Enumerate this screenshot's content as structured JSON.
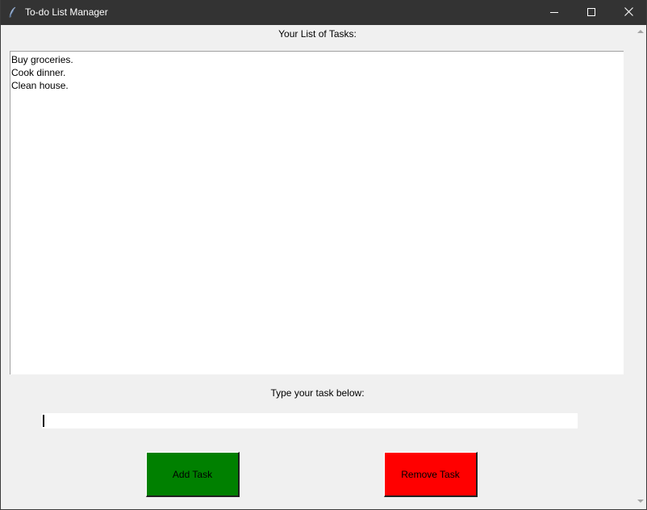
{
  "window": {
    "title": "To-do List Manager",
    "icon": "feather-icon"
  },
  "list": {
    "label": "Your List of Tasks:",
    "items": [
      "Buy groceries.",
      "Cook dinner.",
      "Clean house."
    ]
  },
  "entry": {
    "label": "Type your task below:",
    "value": ""
  },
  "buttons": {
    "add_label": "Add Task",
    "add_color": "#008000",
    "remove_label": "Remove Task",
    "remove_color": "#ff0000"
  }
}
